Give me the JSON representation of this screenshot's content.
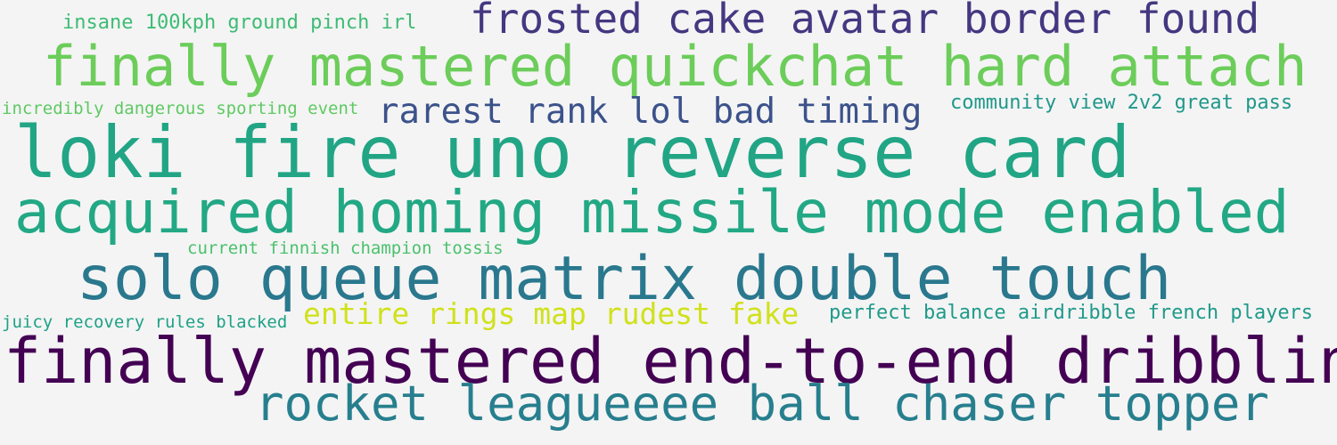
{
  "phrases": [
    {
      "text": "insane 100kph ground pinch irl",
      "color": "#3dbc74"
    },
    {
      "text": "frosted cake avatar border found",
      "color": "#453781"
    },
    {
      "text": "finally mastered quickchat hard attach",
      "color": "#6ccd5a"
    },
    {
      "text": "incredibly dangerous sporting event",
      "color": "#5ec962"
    },
    {
      "text": "rarest rank lol bad timing",
      "color": "#3b528b"
    },
    {
      "text": "community view 2v2 great pass",
      "color": "#1f988b"
    },
    {
      "text": "loki fire uno reverse card",
      "color": "#21a585"
    },
    {
      "text": "acquired homing missile mode enabled",
      "color": "#22a884"
    },
    {
      "text": "current finnish champion tossis",
      "color": "#4ac16d"
    },
    {
      "text": "solo queue matrix double touch",
      "color": "#2a788e"
    },
    {
      "text": "juicy recovery rules blacked",
      "color": "#1fa187"
    },
    {
      "text": "entire rings map rudest fake",
      "color": "#d0e11c"
    },
    {
      "text": "perfect balance airdribble french players",
      "color": "#1f9a8a"
    },
    {
      "text": "finally mastered end-to-end dribbling",
      "color": "#440154"
    },
    {
      "text": "rocket leagueeee ball chaser topper",
      "color": "#277f8e"
    }
  ]
}
